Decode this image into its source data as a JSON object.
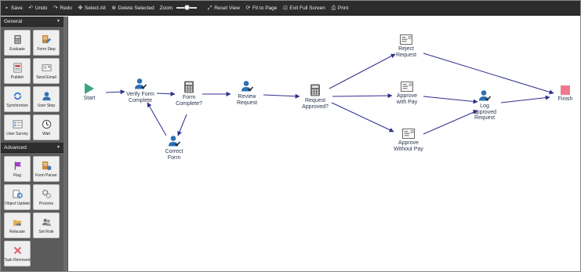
{
  "toolbar": {
    "save": "Save",
    "undo": "Undo",
    "redo": "Redo",
    "select_all": "Select All",
    "delete_selected": "Delete Selected",
    "zoom": "Zoom",
    "reset_view": "Reset View",
    "fit_to_page": "Fit to Page",
    "exit_full_screen": "Exit Full Screen",
    "print": "Print"
  },
  "sidebar": {
    "general": {
      "title": "General",
      "items": [
        "Evaluate",
        "Form Step",
        "Publish",
        "Send Email",
        "Synchronize",
        "User Step",
        "User Survey",
        "Wait"
      ]
    },
    "advanced": {
      "title": "Advanced",
      "items": [
        "Flag",
        "Form Parser",
        "Object Update",
        "Process",
        "Relocate",
        "Set Role",
        "Task Removed"
      ]
    }
  },
  "workflow": {
    "start": "Start",
    "verify_form": [
      "Verify Form",
      "Complete"
    ],
    "form_complete": [
      "Form",
      "Complete?"
    ],
    "correct_form": [
      "Correct",
      "Form"
    ],
    "review_request": [
      "Review",
      "Request"
    ],
    "request_approved": [
      "Request",
      "Approved?"
    ],
    "reject_request": [
      "Reject",
      "Request"
    ],
    "approve_with_pay": [
      "Approve",
      "with Pay"
    ],
    "approve_without_pay": [
      "Approve",
      "Without Pay"
    ],
    "log_approved": [
      "Log",
      "Approved",
      "Request"
    ],
    "finish": "Finish"
  },
  "colors": {
    "edge": "#2f2f8f",
    "start": "#3aa57a",
    "finish": "#ef7a8f",
    "user": "#2f6fb3",
    "toolbar": "#2c2c2c",
    "sidebar": "#5b5b5b"
  }
}
